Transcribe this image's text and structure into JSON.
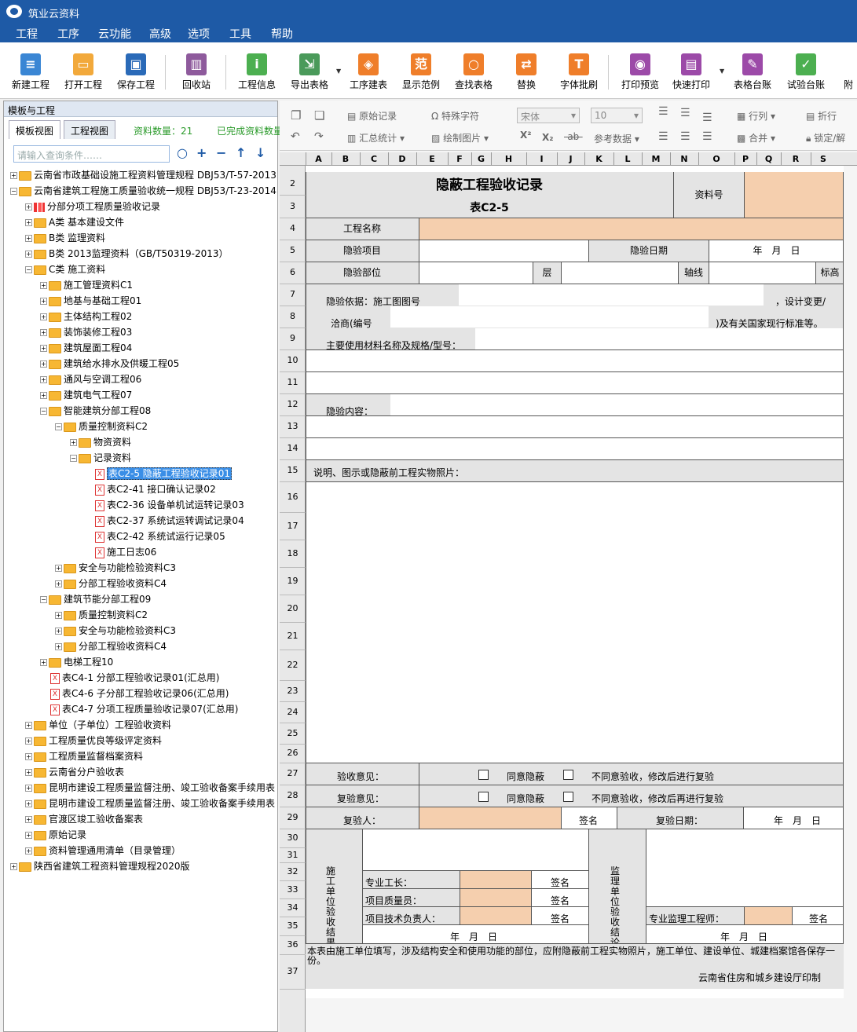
{
  "app": {
    "title": "筑业云资料"
  },
  "menu": [
    "工程",
    "工序",
    "云功能",
    "高级",
    "选项",
    "工具",
    "帮助"
  ],
  "toolbar": {
    "new": "新建工程",
    "open": "打开工程",
    "save": "保存工程",
    "recycle": "回收站",
    "info": "工程信息",
    "export": "导出表格",
    "build": "工序建表",
    "sample": "显示范例",
    "find": "查找表格",
    "replace": "替换",
    "font": "字体批刷",
    "preview": "打印预览",
    "print": "快速打印",
    "ledger": "表格台账",
    "testledger": "试验台账",
    "more": "附"
  },
  "left": {
    "header": "模板与工程",
    "tab1": "模板视图",
    "tab2": "工程视图",
    "count": "资料数量：21",
    "done": "已完成资料数量",
    "search_placeholder": "请输入查询条件……"
  },
  "tree": [
    {
      "t": "云南省市政基础设施工程资料管理规程 DBJ53/T-57-2013",
      "d": 0,
      "k": "f",
      "e": "+"
    },
    {
      "t": "云南省建筑工程施工质量验收统一规程 DBJ53/T-23-2014",
      "d": 0,
      "k": "f",
      "e": "-"
    },
    {
      "t": "分部分项工程质量验收记录",
      "d": 1,
      "k": "b",
      "e": "+"
    },
    {
      "t": "A类 基本建设文件",
      "d": 1,
      "k": "f",
      "e": "+"
    },
    {
      "t": "B类 监理资料",
      "d": 1,
      "k": "f",
      "e": "+"
    },
    {
      "t": "B类 2013监理资料（GB/T50319-2013）",
      "d": 1,
      "k": "f",
      "e": "+"
    },
    {
      "t": "C类 施工资料",
      "d": 1,
      "k": "f",
      "e": "-"
    },
    {
      "t": "施工管理资料C1",
      "d": 2,
      "k": "f",
      "e": "+"
    },
    {
      "t": "地基与基础工程01",
      "d": 2,
      "k": "f",
      "e": "+"
    },
    {
      "t": "主体结构工程02",
      "d": 2,
      "k": "f",
      "e": "+"
    },
    {
      "t": "装饰装修工程03",
      "d": 2,
      "k": "f",
      "e": "+"
    },
    {
      "t": "建筑屋面工程04",
      "d": 2,
      "k": "f",
      "e": "+"
    },
    {
      "t": "建筑给水排水及供暖工程05",
      "d": 2,
      "k": "f",
      "e": "+"
    },
    {
      "t": "通风与空调工程06",
      "d": 2,
      "k": "f",
      "e": "+"
    },
    {
      "t": "建筑电气工程07",
      "d": 2,
      "k": "f",
      "e": "+"
    },
    {
      "t": "智能建筑分部工程08",
      "d": 2,
      "k": "f",
      "e": "-"
    },
    {
      "t": "质量控制资料C2",
      "d": 3,
      "k": "f",
      "e": "-"
    },
    {
      "t": "物资资料",
      "d": 4,
      "k": "f",
      "e": "+"
    },
    {
      "t": "记录资料",
      "d": 4,
      "k": "f",
      "e": "-"
    },
    {
      "t": "表C2-5 隐蔽工程验收记录01",
      "d": 5,
      "k": "x",
      "e": "",
      "sel": true
    },
    {
      "t": "表C2-41 接口确认记录02",
      "d": 5,
      "k": "x",
      "e": ""
    },
    {
      "t": "表C2-36 设备单机试运转记录03",
      "d": 5,
      "k": "x",
      "e": ""
    },
    {
      "t": "表C2-37 系统试运转调试记录04",
      "d": 5,
      "k": "x",
      "e": ""
    },
    {
      "t": "表C2-42 系统试运行记录05",
      "d": 5,
      "k": "x",
      "e": ""
    },
    {
      "t": "施工日志06",
      "d": 5,
      "k": "x",
      "e": ""
    },
    {
      "t": "安全与功能检验资料C3",
      "d": 3,
      "k": "f",
      "e": "+"
    },
    {
      "t": "分部工程验收资料C4",
      "d": 3,
      "k": "f",
      "e": "+"
    },
    {
      "t": "建筑节能分部工程09",
      "d": 2,
      "k": "f",
      "e": "-"
    },
    {
      "t": "质量控制资料C2",
      "d": 3,
      "k": "f",
      "e": "+"
    },
    {
      "t": "安全与功能检验资料C3",
      "d": 3,
      "k": "f",
      "e": "+"
    },
    {
      "t": "分部工程验收资料C4",
      "d": 3,
      "k": "f",
      "e": "+"
    },
    {
      "t": "电梯工程10",
      "d": 2,
      "k": "f",
      "e": "+"
    },
    {
      "t": "表C4-1 分部工程验收记录01(汇总用)",
      "d": 2,
      "k": "x",
      "e": ""
    },
    {
      "t": "表C4-6 子分部工程验收记录06(汇总用)",
      "d": 2,
      "k": "x",
      "e": ""
    },
    {
      "t": "表C4-7 分项工程质量验收记录07(汇总用)",
      "d": 2,
      "k": "x",
      "e": ""
    },
    {
      "t": "单位（子单位）工程验收资料",
      "d": 1,
      "k": "f",
      "e": "+"
    },
    {
      "t": "工程质量优良等级评定资料",
      "d": 1,
      "k": "f",
      "e": "+"
    },
    {
      "t": "工程质量监督档案资料",
      "d": 1,
      "k": "f",
      "e": "+"
    },
    {
      "t": "云南省分户验收表",
      "d": 1,
      "k": "f",
      "e": "+"
    },
    {
      "t": "昆明市建设工程质量监督注册、竣工验收备案手续用表",
      "d": 1,
      "k": "f",
      "e": "+"
    },
    {
      "t": "昆明市建设工程质量监督注册、竣工验收备案手续用表",
      "d": 1,
      "k": "f",
      "e": "+"
    },
    {
      "t": "官渡区竣工验收备案表",
      "d": 1,
      "k": "f",
      "e": "+"
    },
    {
      "t": "原始记录",
      "d": 1,
      "k": "f",
      "e": "+"
    },
    {
      "t": "资料管理通用清单（目录管理）",
      "d": 1,
      "k": "f",
      "e": "+"
    },
    {
      "t": "陕西省建筑工程资料管理规程2020版",
      "d": 0,
      "k": "f",
      "e": "+"
    }
  ],
  "fmt": {
    "orig": "原始记录",
    "summary": "汇总统计",
    "special": "特殊字符",
    "draw": "绘制图片",
    "font": "宋体",
    "size": "10",
    "ref": "参考数据",
    "row": "行列",
    "merge": "合并",
    "wrap": "折行",
    "lock": "锁定/解"
  },
  "cols": [
    "A",
    "B",
    "C",
    "D",
    "E",
    "F",
    "G",
    "H",
    "I",
    "J",
    "K",
    "L",
    "M",
    "N",
    "O",
    "P",
    "Q",
    "R",
    "S"
  ],
  "rows": [
    "2",
    "3",
    "4",
    "5",
    "6",
    "7",
    "8",
    "9",
    "10",
    "11",
    "12",
    "13",
    "14",
    "15",
    "16",
    "17",
    "18",
    "19",
    "20",
    "21",
    "22",
    "23",
    "24",
    "25",
    "26",
    "27",
    "28",
    "29",
    "30",
    "31",
    "32",
    "33",
    "34",
    "35",
    "36",
    "37"
  ],
  "form": {
    "title": "隐蔽工程验收记录",
    "code": "表C2-5",
    "doc_no": "资料号",
    "proj_name": "工程名称",
    "item": "隐验项目",
    "date": "隐验日期",
    "ymd": "年　月　日",
    "part": "隐验部位",
    "floor": "层",
    "axis": "轴线",
    "elev": "标高",
    "basis": "隐验依据：施工图图号",
    "design": "，设计变更/",
    "nego": "洽商(编号",
    "std": ")及有关国家现行标准等。",
    "material": "主要使用材料名称及规格/型号：",
    "content": "隐验内容：",
    "photo": "说明、图示或隐蔽前工程实物照片：",
    "opinion": "验收意见：",
    "recheck_op": "复验意见：",
    "agree": "同意隐蔽",
    "disagree1": "不同意验收，修改后进行复验",
    "disagree2": "不同意验收，修改后再进行复验",
    "rechecker": "复验人：",
    "sign": "签名",
    "recheck_date": "复验日期：",
    "unit_result": "施工单位验收结果",
    "foreman": "专业工长：",
    "qc": "项目质量员：",
    "tech": "项目技术负责人：",
    "sup_result": "监理单位验收结论",
    "engineer": "专业监理工程师：",
    "note": "本表由施工单位填写，涉及结构安全和使用功能的部位，应附隐蔽前工程实物照片，施工单位、建设单位、城建档案馆各保存一份。",
    "printer": "云南省住房和城乡建设厅印制"
  }
}
